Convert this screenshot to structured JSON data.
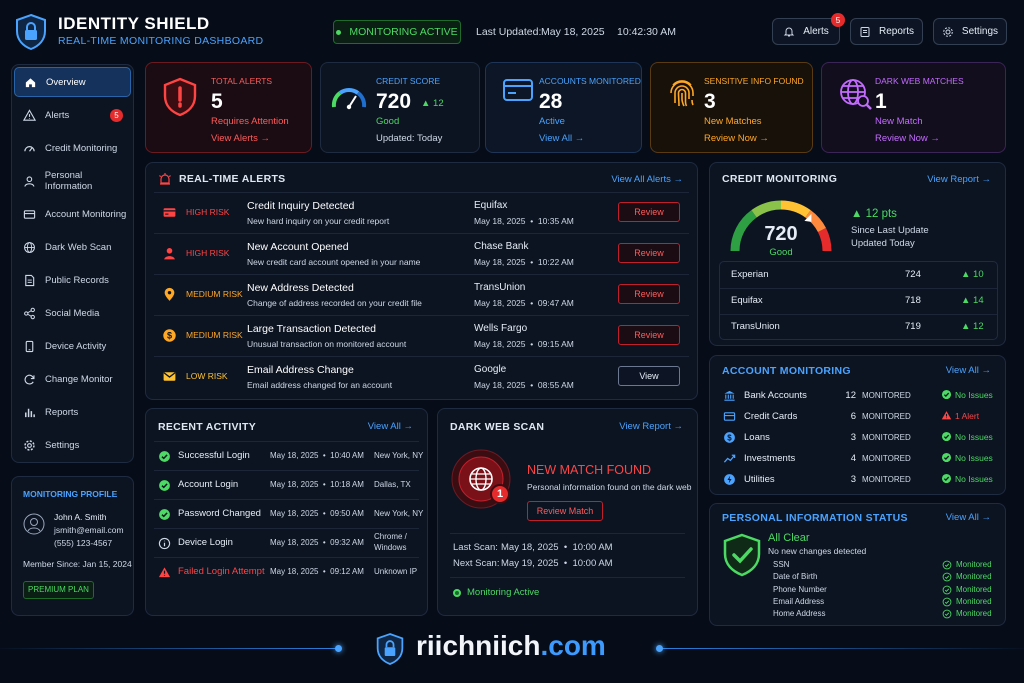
{
  "brand": {
    "title": "IDENTITY SHIELD",
    "subtitle": "REAL-TIME MONITORING DASHBOARD"
  },
  "header": {
    "status": "MONITORING ACTIVE",
    "updated_label": "Last Updated:",
    "updated_date": "May 18, 2025",
    "updated_time": "10:42:30 AM",
    "alerts_label": "Alerts",
    "alerts_count": "5",
    "reports_label": "Reports",
    "settings_label": "Settings"
  },
  "sidebar": {
    "items": [
      {
        "label": "Overview",
        "icon": "home-icon"
      },
      {
        "label": "Alerts",
        "icon": "warning-icon",
        "badge": "5"
      },
      {
        "label": "Credit Monitoring",
        "icon": "gauge-icon"
      },
      {
        "label": "Personal Information",
        "icon": "user-icon"
      },
      {
        "label": "Account Monitoring",
        "icon": "card-icon"
      },
      {
        "label": "Dark Web Scan",
        "icon": "globe-icon"
      },
      {
        "label": "Public Records",
        "icon": "document-icon"
      },
      {
        "label": "Social Media",
        "icon": "share-icon"
      },
      {
        "label": "Device Activity",
        "icon": "device-icon"
      },
      {
        "label": "Change Monitor",
        "icon": "refresh-icon"
      },
      {
        "label": "Reports",
        "icon": "bar-chart-icon"
      },
      {
        "label": "Settings",
        "icon": "gear-icon"
      }
    ]
  },
  "profile": {
    "title": "MONITORING PROFILE",
    "name": "John A. Smith",
    "email": "jsmith@email.com",
    "phone": "(555) 123-4567",
    "member": "Member Since: Jan 15, 2024",
    "plan": "PREMIUM PLAN"
  },
  "stats": [
    {
      "title": "TOTAL ALERTS",
      "value": "5",
      "sub": "Requires Attention",
      "link": "View Alerts →"
    },
    {
      "title": "CREDIT SCORE",
      "value": "720",
      "delta": "▲ 12",
      "sub": "Good",
      "link": "Updated: Today"
    },
    {
      "title": "ACCOUNTS MONITORED",
      "value": "28",
      "sub": "Active",
      "link": "View All →"
    },
    {
      "title": "SENSITIVE INFO FOUND",
      "value": "3",
      "sub": "New Matches",
      "link": "Review Now →"
    },
    {
      "title": "DARK WEB MATCHES",
      "value": "1",
      "sub": "New Match",
      "link": "Review Now →"
    }
  ],
  "alerts": {
    "title": "REAL-TIME ALERTS",
    "link": "View All Alerts →",
    "rows": [
      {
        "level": "HIGH RISK",
        "title": "Credit Inquiry Detected",
        "desc": "New hard inquiry on your credit report",
        "source": "Equifax",
        "time": "May 18, 2025  •  10:35 AM",
        "action": "Review"
      },
      {
        "level": "HIGH RISK",
        "title": "New Account Opened",
        "desc": "New credit card account opened in your name",
        "source": "Chase Bank",
        "time": "May 18, 2025  •  10:22 AM",
        "action": "Review"
      },
      {
        "level": "MEDIUM RISK",
        "title": "New Address Detected",
        "desc": "Change of address recorded on your credit file",
        "source": "TransUnion",
        "time": "May 18, 2025  •  09:47 AM",
        "action": "Review"
      },
      {
        "level": "MEDIUM RISK",
        "title": "Large Transaction Detected",
        "desc": "Unusual transaction on monitored account",
        "source": "Wells Fargo",
        "time": "May 18, 2025  •  09:15 AM",
        "action": "Review"
      },
      {
        "level": "LOW RISK",
        "title": "Email Address Change",
        "desc": "Email address changed for an account",
        "source": "Google",
        "time": "May 18, 2025  •  08:55 AM",
        "action": "View"
      }
    ]
  },
  "credit": {
    "title": "CREDIT MONITORING",
    "link": "View Report →",
    "score": "720",
    "rating": "Good",
    "score_fraction": 0.72,
    "delta": "▲ 12 pts",
    "since": "Since Last Update",
    "updated": "Updated Today",
    "bureaus": [
      {
        "name": "Experian",
        "score": "724",
        "delta": "▲ 10"
      },
      {
        "name": "Equifax",
        "score": "718",
        "delta": "▲ 14"
      },
      {
        "name": "TransUnion",
        "score": "719",
        "delta": "▲ 12"
      }
    ]
  },
  "activity": {
    "title": "RECENT ACTIVITY",
    "link": "View All →",
    "rows": [
      {
        "event": "Successful Login",
        "time": "May 18, 2025  •  10:40 AM",
        "loc": "New York, NY",
        "status": "ok"
      },
      {
        "event": "Account Login",
        "time": "May 18, 2025  •  10:18 AM",
        "loc": "Dallas, TX",
        "status": "ok"
      },
      {
        "event": "Password Changed",
        "time": "May 18, 2025  •  09:50 AM",
        "loc": "New York, NY",
        "status": "ok"
      },
      {
        "event": "Device Login",
        "time": "May 18, 2025  •  09:32 AM",
        "loc": "Chrome /",
        "loc2": "Windows",
        "status": "info"
      },
      {
        "event": "Failed Login Attempt",
        "time": "May 18, 2025  •  09:12 AM",
        "loc": "Unknown IP",
        "status": "fail"
      }
    ]
  },
  "darkweb": {
    "title": "DARK WEB SCAN",
    "link": "View Report →",
    "badge": "1",
    "headline": "NEW MATCH FOUND",
    "desc": "Personal information found on the dark web",
    "button": "Review Match",
    "last_label": "Last Scan:",
    "last": "May 18, 2025  •  10:00 AM",
    "next_label": "Next Scan:",
    "next": "May 19, 2025  •  10:00 AM",
    "status": "Monitoring Active"
  },
  "accounts": {
    "title": "ACCOUNT MONITORING",
    "link": "View All →",
    "rows": [
      {
        "name": "Bank Accounts",
        "count": "12",
        "label": "MONITORED",
        "status": "No Issues",
        "ok": true
      },
      {
        "name": "Credit Cards",
        "count": "6",
        "label": "MONITORED",
        "status": "1 Alert",
        "ok": false
      },
      {
        "name": "Loans",
        "count": "3",
        "label": "MONITORED",
        "status": "No Issues",
        "ok": true
      },
      {
        "name": "Investments",
        "count": "4",
        "label": "MONITORED",
        "status": "No Issues",
        "ok": true
      },
      {
        "name": "Utilities",
        "count": "3",
        "label": "MONITORED",
        "status": "No Issues",
        "ok": true
      }
    ]
  },
  "personal": {
    "title": "PERSONAL INFORMATION STATUS",
    "link": "View All →",
    "headline": "All Clear",
    "sub": "No new changes detected",
    "items": [
      {
        "name": "SSN",
        "status": "Monitored"
      },
      {
        "name": "Date of Birth",
        "status": "Monitored"
      },
      {
        "name": "Phone Number",
        "status": "Monitored"
      },
      {
        "name": "Email Address",
        "status": "Monitored"
      },
      {
        "name": "Home Address",
        "status": "Monitored"
      }
    ]
  },
  "footer": {
    "brand_main": "riichniich",
    "brand_tld": ".com"
  },
  "colors": {
    "accent": "#4aa3ff",
    "danger": "#ff4444",
    "success": "#4cd964",
    "warning": "#ffa726",
    "purple": "#c46bff",
    "background": "#070d18"
  }
}
